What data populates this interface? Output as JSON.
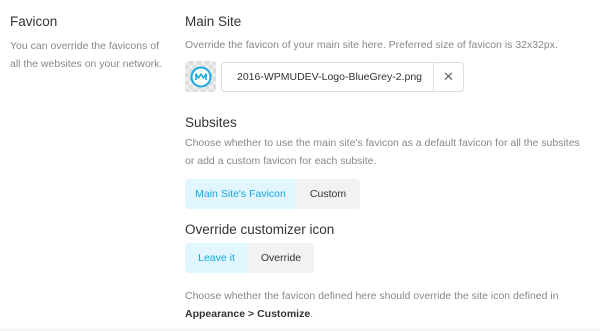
{
  "favicon": {
    "title": "Favicon",
    "description": "You can override the favicons of all the websites on your network."
  },
  "main_site": {
    "title": "Main Site",
    "description": "Override the favicon of your main site here. Preferred size of favicon is 32x32px.",
    "file_name": "2016-WPMUDEV-Logo-BlueGrey-2.png",
    "clear_symbol": "✕"
  },
  "subsites": {
    "title": "Subsites",
    "description": "Choose whether to use the main site's favicon as a default favicon for all the subsites or add a custom favicon for each subsite.",
    "options": [
      "Main Site's Favicon",
      "Custom"
    ]
  },
  "override": {
    "title": "Override customizer icon",
    "options": [
      "Leave it",
      "Override"
    ],
    "description_prefix": "Choose whether the favicon defined here should override the site icon defined in ",
    "description_bold": "Appearance > Customize",
    "description_suffix": "."
  },
  "colors": {
    "accent": "#17a8e3",
    "accent_bg": "#e1f6ff",
    "inactive_bg": "#f2f2f2",
    "muted_text": "#888888"
  }
}
